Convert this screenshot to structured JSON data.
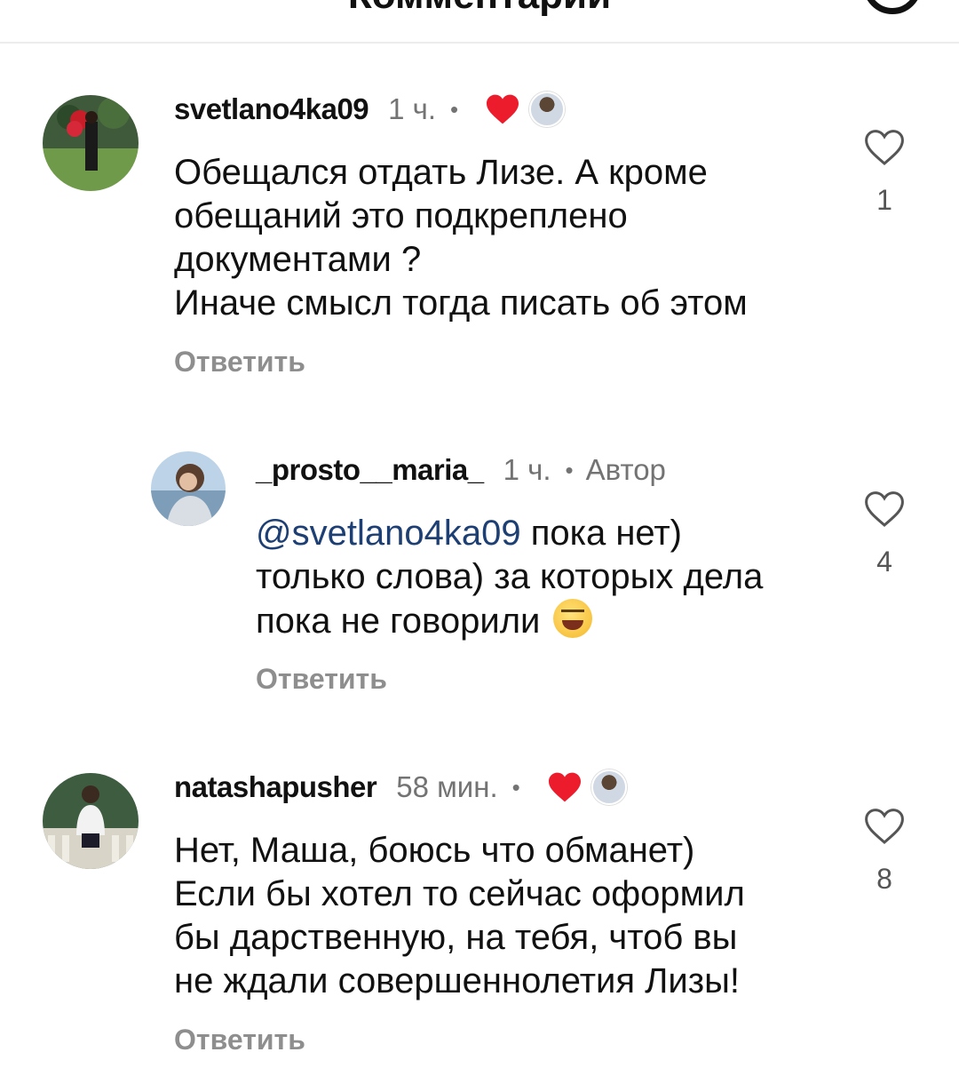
{
  "header": {
    "title": "Комментарии"
  },
  "comments": [
    {
      "username": "svetlano4ka09",
      "time": "1 ч.",
      "text": "Обещался отдать Лизе. А кроме\nобещаний это подкреплено\nдокументами ?\nИначе смысл тогда писать об этом",
      "reply_label": "Ответить",
      "likes": "1"
    },
    {
      "username": "_prosto__maria_",
      "time": "1 ч.",
      "author_badge": "Автор",
      "mention": "@svetlano4ka09",
      "text": " пока нет)\nтолько слова) за которых дела\nпока не говорили ",
      "reply_label": "Ответить",
      "likes": "4"
    },
    {
      "username": "natashapusher",
      "time": "58 мин.",
      "text": "Нет, Маша, боюсь что обманет)\nЕсли бы хотел то сейчас оформил\nбы дарственную, на тебя, чтоб вы\nне ждали совершеннолетия Лизы!",
      "reply_label": "Ответить",
      "likes": "8"
    }
  ],
  "colors": {
    "like_red": "#ed1c2c",
    "secondary_text": "#737373",
    "mention": "#1d3f73"
  },
  "icons": [
    "heart-outline-icon",
    "liked-by-author-heart-icon",
    "grinning-squinting-face-emoji"
  ]
}
